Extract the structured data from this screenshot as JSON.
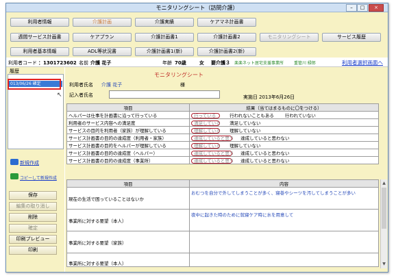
{
  "window": {
    "title": "モニタリングシート（訪問介護）",
    "minimize": "–",
    "maximize": "□",
    "close": "×"
  },
  "nav_row1": [
    "利用者情報",
    "介護計画",
    "介護実績",
    "ケアマネ計画書"
  ],
  "nav_row2": [
    "週間サービス計画書",
    "ケアプラン",
    "介護計画書1",
    "介護計画書2",
    "モニタリングシート",
    "サービス履歴"
  ],
  "nav_row3": [
    "利用者基本情報",
    "ADL等状況書",
    "介護計画書1(新)",
    "介護計画書2(新)"
  ],
  "info": {
    "code_label": "利用者コード",
    "code_value": "：1301723602",
    "name_label": "名前",
    "name_value": "介護 花子",
    "age_label": "年齢",
    "age_value": "70歳",
    "sex": "女",
    "care_level": "要介護３",
    "office": "楽楽ネット居宅支援事業所",
    "manager": "重管川 緑郎",
    "select_link": "利用者選択画面へ"
  },
  "left": {
    "history_label": "履歴",
    "history_item": "013/06/26 確定",
    "new_link": "新規作成",
    "copy_link": "コピーして新規作成",
    "buttons": {
      "save": "保存",
      "cancel": "編集の取り消し",
      "delete": "削除",
      "confirm": "確定",
      "preview": "印刷プレビュー",
      "print": "印刷"
    }
  },
  "sheet": {
    "title": "モニタリングシート",
    "user_label": "利用者氏名",
    "user_value": "介護 花子",
    "sama": "様",
    "writer_label": "記入者氏名",
    "writer_value": "",
    "date_label": "実施日",
    "date_value": "2013年6月26日"
  },
  "eval": {
    "col_item": "項目",
    "col_result": "結果（当てはまるものに〇をつける）",
    "rows": [
      {
        "item": "ヘルパーは仕事を計画書に沿って行っている",
        "opts": [
          "行っている",
          "行われないこともある",
          "行われていない"
        ]
      },
      {
        "item": "利用者のサービス内容への満足度",
        "opts": [
          "満足している",
          "満足していない"
        ]
      },
      {
        "item": "サービスの目的を利用者（家族）が理解している",
        "opts": [
          "理解している",
          "理解していない"
        ]
      },
      {
        "item": "サービス計画書の目的の達成度（利用者・家族）",
        "opts": [
          "達成していると思う",
          "達成していると思わない"
        ]
      },
      {
        "item": "サービス計画書の目的をヘルパーが理解している",
        "opts": [
          "理解している",
          "理解していない"
        ]
      },
      {
        "item": "サービス計画書の目的の達成度（ヘルパー）",
        "opts": [
          "達成していると思う",
          "達成していると思わない"
        ]
      },
      {
        "item": "サービス計画書の目的の達成度（事業所）",
        "opts": [
          "達成していると思う",
          "達成していると思わない"
        ]
      }
    ]
  },
  "detail": {
    "col_item": "項目",
    "col_content": "内容",
    "rows": [
      {
        "item": "現在の生活で困っていることはないか",
        "content": "おむつを自分で外してしまうことが多く、寝巻やシーツを汚してしまうことが多い"
      },
      {
        "item": "事業所に対する要望（本人）",
        "content": "夜中に起きた時のために就寝ケア時に水を用意して"
      },
      {
        "item": "事業所に対する要望（家族）",
        "content": ""
      },
      {
        "item": "事業所に対する要望（本人）",
        "content": ""
      }
    ]
  },
  "colors": {
    "panel": "#f7f2c4",
    "oval": "#b01c2c",
    "link": "#1a3ec9",
    "highlight": "#3a7ad6"
  }
}
